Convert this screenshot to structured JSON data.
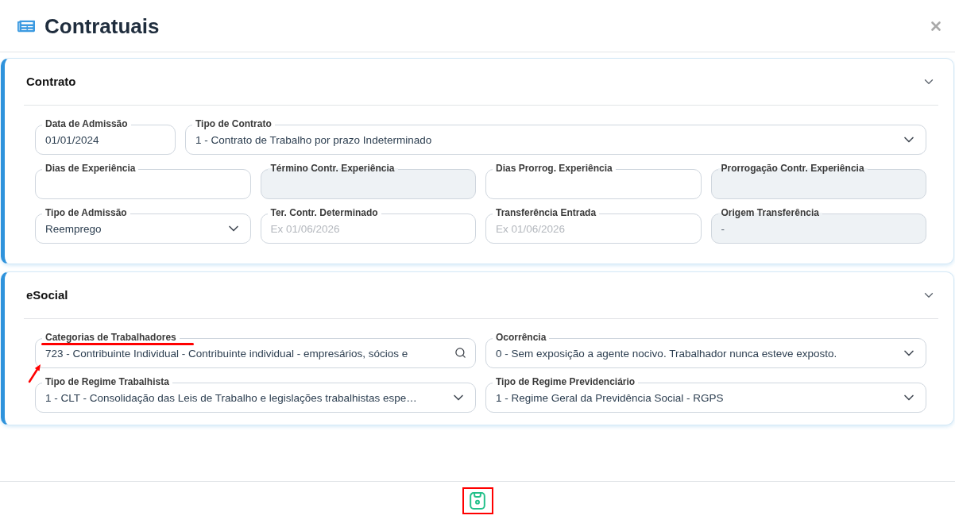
{
  "dialog": {
    "title": "Contratuais"
  },
  "sections": [
    {
      "title": "Contrato",
      "expanded": true,
      "rows": [
        [
          {
            "label": "Data de Admissão",
            "kind": "text",
            "value": "01/01/2024",
            "disabled": false,
            "highlighted": false
          },
          {
            "label": "Tipo de Contrato",
            "kind": "select",
            "value": "1 - Contrato de Trabalho por prazo Indeterminado",
            "disabled": false,
            "highlighted": false
          }
        ],
        [
          {
            "label": "Dias de Experiência",
            "kind": "text",
            "disabled": false,
            "highlighted": false
          },
          {
            "label": "Término Contr. Experiência",
            "kind": "text",
            "disabled": true,
            "highlighted": false
          },
          {
            "label": "Dias Prorrog. Experiência",
            "kind": "text",
            "disabled": false,
            "highlighted": false
          },
          {
            "label": "Prorrogação Contr. Experiência",
            "kind": "text",
            "disabled": true,
            "highlighted": false
          }
        ],
        [
          {
            "label": "Tipo de Admissão",
            "kind": "select",
            "value": "Reemprego",
            "disabled": false,
            "highlighted": false
          },
          {
            "label": "Ter. Contr. Determinado",
            "kind": "text",
            "placeholder": "Ex 01/06/2026",
            "disabled": false,
            "highlighted": false
          },
          {
            "label": "Transferência Entrada",
            "kind": "text",
            "placeholder": "Ex 01/06/2026",
            "disabled": false,
            "highlighted": false
          },
          {
            "label": "Origem Transferência",
            "kind": "text",
            "value": "-",
            "disabled": true,
            "highlighted": false
          }
        ]
      ]
    },
    {
      "title": "eSocial",
      "expanded": true,
      "rows": [
        [
          {
            "label": "Categorias de Trabalhadores",
            "kind": "search",
            "value": "723 - Contribuinte Individual - Contribuinte individual - empresários, sócios e",
            "disabled": false,
            "highlighted": true
          },
          {
            "label": "Ocorrência",
            "kind": "select",
            "value": "0 - Sem exposição a agente nocivo. Trabalhador nunca esteve exposto.",
            "disabled": false,
            "highlighted": false
          }
        ],
        [
          {
            "label": "Tipo de Regime Trabalhista",
            "kind": "select",
            "value": "1 - CLT - Consolidação das Leis de Trabalho e legislações trabalhistas espe…",
            "disabled": false,
            "highlighted": false
          },
          {
            "label": "Tipo de Regime Previdenciário",
            "kind": "select",
            "value": "1 - Regime Geral da Previdência Social - RGPS",
            "disabled": false,
            "highlighted": false
          }
        ]
      ]
    }
  ],
  "footer": {
    "save_button": {
      "highlighted": true
    }
  }
}
